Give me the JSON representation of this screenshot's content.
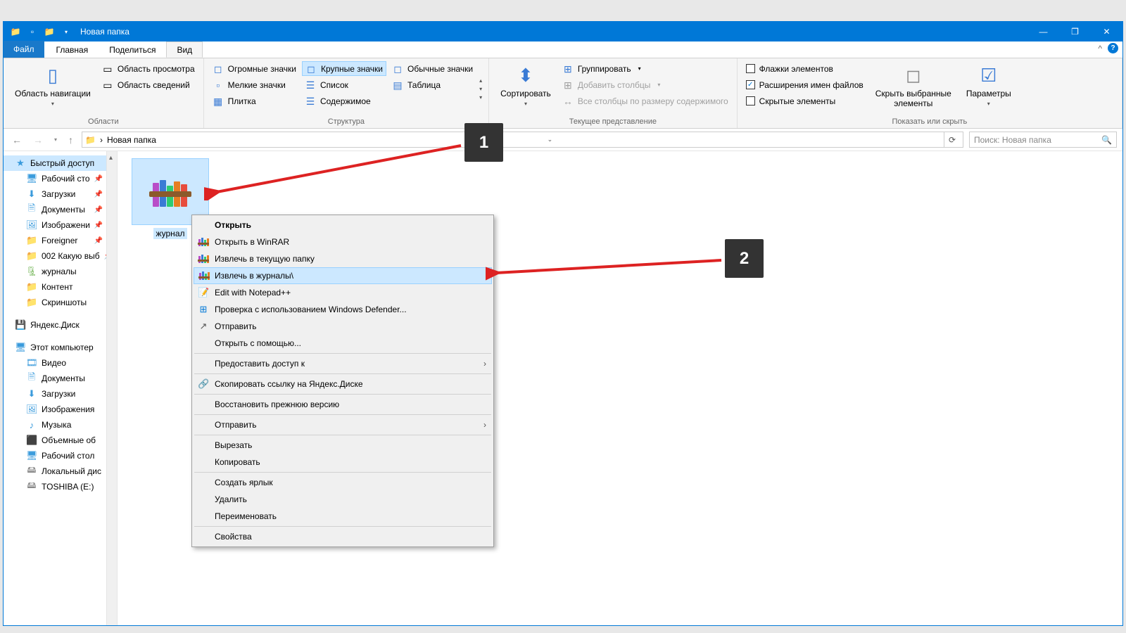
{
  "window": {
    "title": "Новая папка",
    "minimize": "—",
    "maximize": "❐",
    "close": "✕"
  },
  "tabs": {
    "file": "Файл",
    "home": "Главная",
    "share": "Поделиться",
    "view": "Вид",
    "collapse": "^"
  },
  "ribbon": {
    "panes": {
      "nav_pane": "Область навигации",
      "preview": "Область просмотра",
      "details": "Область сведений",
      "group": "Области"
    },
    "layout": {
      "extra_large": "Огромные значки",
      "large": "Крупные значки",
      "medium": "Обычные значки",
      "small": "Мелкие значки",
      "list": "Список",
      "details": "Таблица",
      "tiles": "Плитка",
      "content": "Содержимое",
      "group": "Структура"
    },
    "current": {
      "sort": "Сортировать",
      "group_by": "Группировать",
      "add_columns": "Добавить столбцы",
      "size_all": "Все столбцы по размеру содержимого",
      "group": "Текущее представление"
    },
    "show": {
      "checkboxes": "Флажки элементов",
      "extensions": "Расширения имен файлов",
      "hidden": "Скрытые элементы",
      "hide_selected": "Скрыть выбранные элементы",
      "options": "Параметры",
      "group": "Показать или скрыть"
    }
  },
  "address": {
    "current": "Новая папка",
    "sep": "›"
  },
  "search": {
    "placeholder": "Поиск: Новая папка"
  },
  "sidebar": {
    "quick": "Быстрый доступ",
    "desktop": "Рабочий сто",
    "downloads": "Загрузки",
    "documents": "Документы",
    "pictures": "Изображени",
    "foreigner": "Foreigner",
    "folder002": "002 Какую выб",
    "journals": "журналы",
    "content": "Контент",
    "screenshots": "Скриншоты",
    "yandex": "Яндекс.Диск",
    "thispc": "Этот компьютер",
    "video": "Видео",
    "documents2": "Документы",
    "downloads2": "Загрузки",
    "pictures2": "Изображения",
    "music": "Музыка",
    "objects3d": "Объемные об",
    "desktop2": "Рабочий стол",
    "localdisk": "Локальный дис",
    "toshiba": "TOSHIBA (E:)"
  },
  "file": {
    "name": "журнал"
  },
  "context": {
    "open": "Открыть",
    "open_winrar": "Открыть в WinRAR",
    "extract_here": "Извлечь в текущую папку",
    "extract_to": "Извлечь в журналы\\",
    "edit_npp": "Edit with Notepad++",
    "defender": "Проверка с использованием Windows Defender...",
    "share": "Отправить",
    "open_with": "Открыть с помощью...",
    "give_access": "Предоставить доступ к",
    "copy_yandex": "Скопировать ссылку на Яндекс.Диске",
    "restore": "Восстановить прежнюю версию",
    "send_to": "Отправить",
    "cut": "Вырезать",
    "copy": "Копировать",
    "shortcut": "Создать ярлык",
    "delete": "Удалить",
    "rename": "Переименовать",
    "properties": "Свойства"
  },
  "callouts": {
    "one": "1",
    "two": "2"
  }
}
